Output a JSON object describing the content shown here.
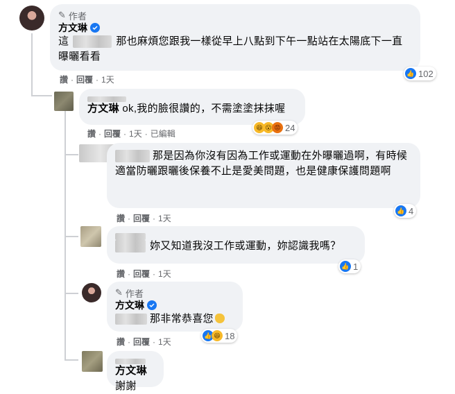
{
  "author_badge": "作者",
  "comment1": {
    "name": "方文琳",
    "text_prefix": "這",
    "text": "那也麻煩您跟我一樣從早上八點到下午一點站在太陽底下一直曝曬看看",
    "actions": [
      "讚",
      "回覆",
      "1天"
    ],
    "reactions": {
      "count": "102",
      "icons": [
        "like-icon"
      ]
    }
  },
  "reply1": {
    "mention": "方文琳",
    "text": "ok,我的臉很讚的，不需塗塗抹抹喔",
    "actions": [
      "讚",
      "回覆",
      "1天",
      "已編輯"
    ],
    "reactions": {
      "count": "24",
      "icons": [
        "haha-icon",
        "wow-icon",
        "angry-icon"
      ]
    }
  },
  "reply2": {
    "text": "那是因為你沒有因為工作或運動在外曝曬過啊，有時候適當防曬跟曬後保養不止是愛美問題，也是健康保護問題啊",
    "actions": [
      "讚",
      "回覆",
      "1天"
    ],
    "reactions": {
      "count": "4",
      "icons": [
        "like-icon"
      ]
    }
  },
  "reply3": {
    "text": "妳又知道我沒工作或運動，妳認識我嗎？",
    "actions": [
      "讚",
      "回覆",
      "1天"
    ],
    "reactions": {
      "count": "1",
      "icons": [
        "like-icon"
      ]
    }
  },
  "reply4": {
    "name": "方文琳",
    "text": "那非常恭喜您",
    "actions": [
      "讚",
      "回覆",
      "1天"
    ],
    "reactions": {
      "count": "18",
      "icons": [
        "like-icon",
        "haha-icon"
      ]
    }
  },
  "reply5": {
    "mention": "方文琳",
    "text": "謝謝"
  }
}
